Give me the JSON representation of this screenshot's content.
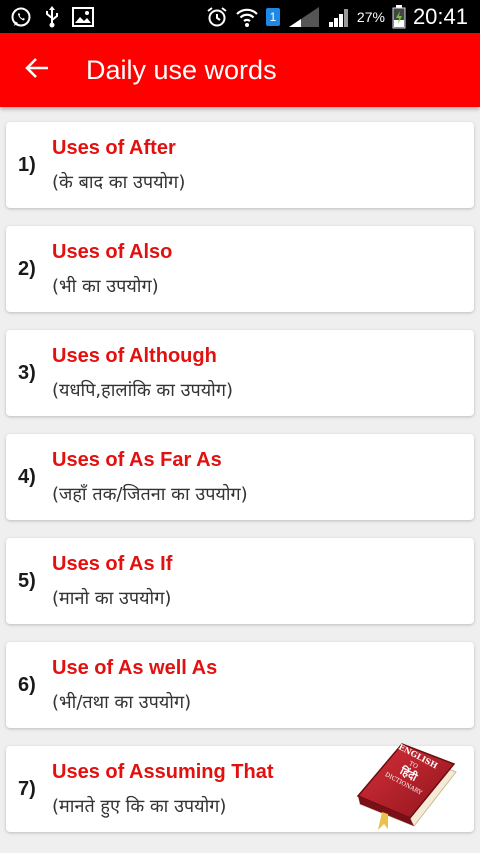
{
  "status_bar": {
    "left_icons": [
      "whatsapp-icon",
      "usb-icon",
      "image-icon"
    ],
    "right_icons": [
      "alarm-icon",
      "wifi-icon",
      "sim-icon",
      "signal-icon",
      "signal-icon",
      "battery-icon"
    ],
    "sim_number": "1",
    "battery_percent": "27%",
    "time": "20:41"
  },
  "app_bar": {
    "title": "Daily use words",
    "background": "#ff0000",
    "back_icon": "arrow-left-icon"
  },
  "items": [
    {
      "number": "1)",
      "title": "Uses of After",
      "subtitle": "(के बाद का उपयोग)"
    },
    {
      "number": "2)",
      "title": "Uses of Also",
      "subtitle": "(भी का उपयोग)"
    },
    {
      "number": "3)",
      "title": "Uses of Although",
      "subtitle": "(यधपि,हालांकि का उपयोग)"
    },
    {
      "number": "4)",
      "title": "Uses of As Far As",
      "subtitle": "(जहाँ तक/जितना का उपयोग)"
    },
    {
      "number": "5)",
      "title": "Uses of As If",
      "subtitle": "(मानो का उपयोग)"
    },
    {
      "number": "6)",
      "title": "Use of As well As",
      "subtitle": "(भी/तथा का उपयोग)"
    },
    {
      "number": "7)",
      "title": "Uses of Assuming That",
      "subtitle": "(मानते हुए कि का उपयोग)"
    }
  ],
  "logo": {
    "icon": "dictionary-book-icon",
    "line1": "ENGLISH",
    "line2": "TO",
    "line3": "हिंदी",
    "line4": "DICTIONARY"
  },
  "colors": {
    "accent": "#ff0000",
    "item_title": "#e31010"
  }
}
